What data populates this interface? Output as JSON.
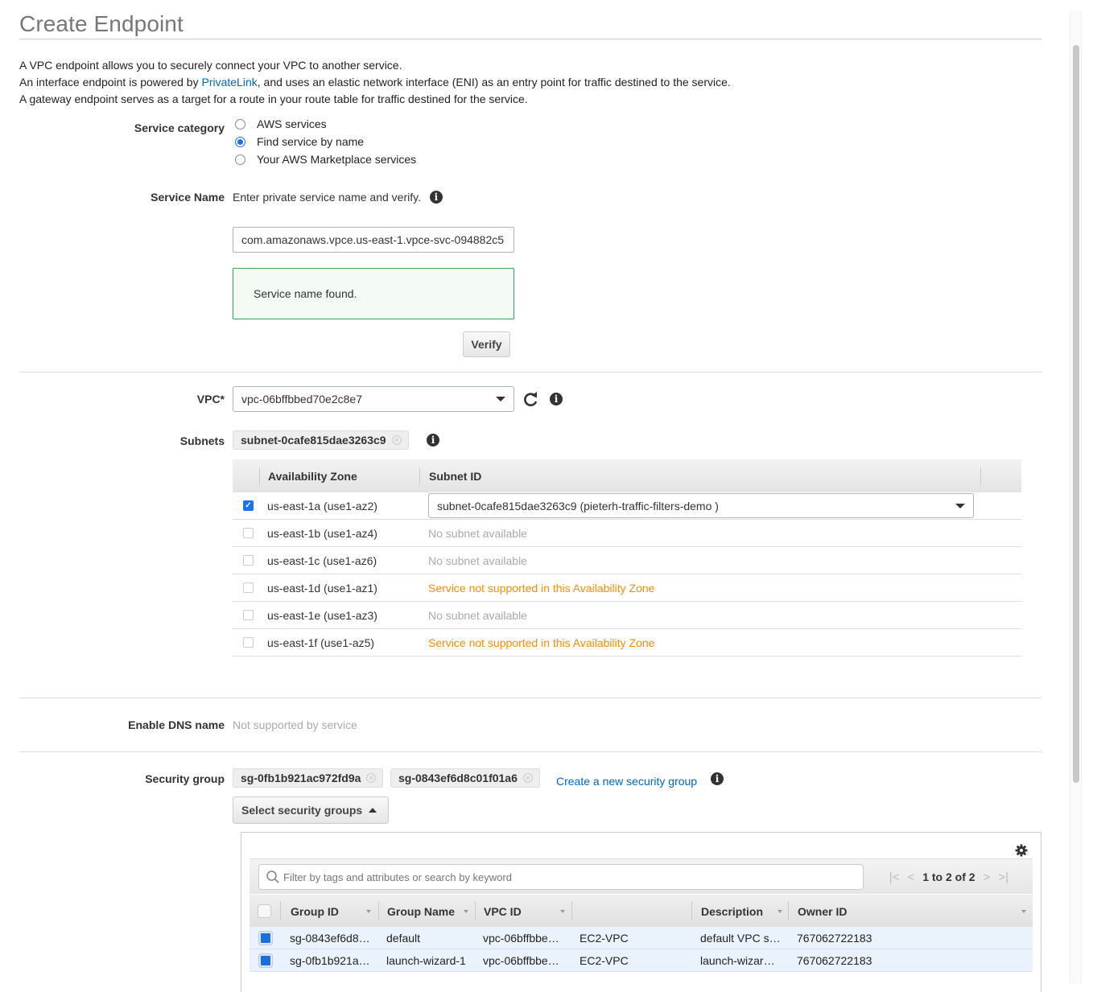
{
  "page": {
    "title": "Create Endpoint",
    "intro": {
      "line1": "A VPC endpoint allows you to securely connect your VPC to another service.",
      "line2_prefix": "An interface endpoint is powered by ",
      "line2_link": "PrivateLink",
      "line2_suffix": ", and uses an elastic network interface (ENI) as an entry point for traffic destined to the service.",
      "line3": "A gateway endpoint serves as a target for a route in your route table for traffic destined for the service."
    }
  },
  "service_category": {
    "label": "Service category",
    "options": [
      {
        "label": "AWS services",
        "selected": false
      },
      {
        "label": "Find service by name",
        "selected": true
      },
      {
        "label": "Your AWS Marketplace services",
        "selected": false
      }
    ]
  },
  "service_name": {
    "label": "Service Name",
    "hint": "Enter private service name and verify.",
    "value": "com.amazonaws.vpce.us-east-1.vpce-svc-094882c5",
    "status": "Service name found.",
    "verify_label": "Verify"
  },
  "vpc": {
    "label": "VPC*",
    "value": "vpc-06bffbbed70e2c8e7"
  },
  "subnets": {
    "label": "Subnets",
    "tokens": [
      "subnet-0cafe815dae3263c9"
    ],
    "columns": [
      "Availability Zone",
      "Subnet ID"
    ],
    "rows": [
      {
        "zone": "us-east-1a (use1-az2)",
        "checked": true,
        "subnet": "subnet-0cafe815dae3263c9 (pieterh-traffic-filters-demo )",
        "type": "select"
      },
      {
        "zone": "us-east-1b (use1-az4)",
        "checked": false,
        "subnet": "No subnet available",
        "type": "muted"
      },
      {
        "zone": "us-east-1c (use1-az6)",
        "checked": false,
        "subnet": "No subnet available",
        "type": "muted"
      },
      {
        "zone": "us-east-1d (use1-az1)",
        "checked": false,
        "subnet": "Service not supported in this Availability Zone",
        "type": "warn"
      },
      {
        "zone": "us-east-1e (use1-az3)",
        "checked": false,
        "subnet": "No subnet available",
        "type": "muted"
      },
      {
        "zone": "us-east-1f (use1-az5)",
        "checked": false,
        "subnet": "Service not supported in this Availability Zone",
        "type": "warn"
      }
    ]
  },
  "dns": {
    "label": "Enable DNS name",
    "value": "Not supported by service"
  },
  "security_group": {
    "label": "Security group",
    "tokens": [
      "sg-0fb1b921ac972fd9a",
      "sg-0843ef6d8c01f01a6"
    ],
    "create_link": "Create a new security group",
    "select_button": "Select security groups",
    "filter_placeholder": "Filter by tags and attributes or search by keyword",
    "pager": "1 to 2 of 2",
    "columns": [
      "Group ID",
      "Group Name",
      "VPC ID",
      "",
      "Description",
      "Owner ID"
    ],
    "rows": [
      {
        "group_id": "sg-0843ef6d8…",
        "group_name": "default",
        "vpc_id": "vpc-06bffbbe…",
        "platform": "EC2-VPC",
        "description": "default VPC s…",
        "owner_id": "767062722183",
        "checked": true
      },
      {
        "group_id": "sg-0fb1b921a…",
        "group_name": "launch-wizard-1",
        "vpc_id": "vpc-06bffbbe…",
        "platform": "EC2-VPC",
        "description": "launch-wizar…",
        "owner_id": "767062722183",
        "checked": true
      }
    ]
  },
  "colors": {
    "link": "#0066c0",
    "warning": "#ff8c00",
    "success_border": "#3aa655",
    "checkbox": "#1a73e8"
  }
}
